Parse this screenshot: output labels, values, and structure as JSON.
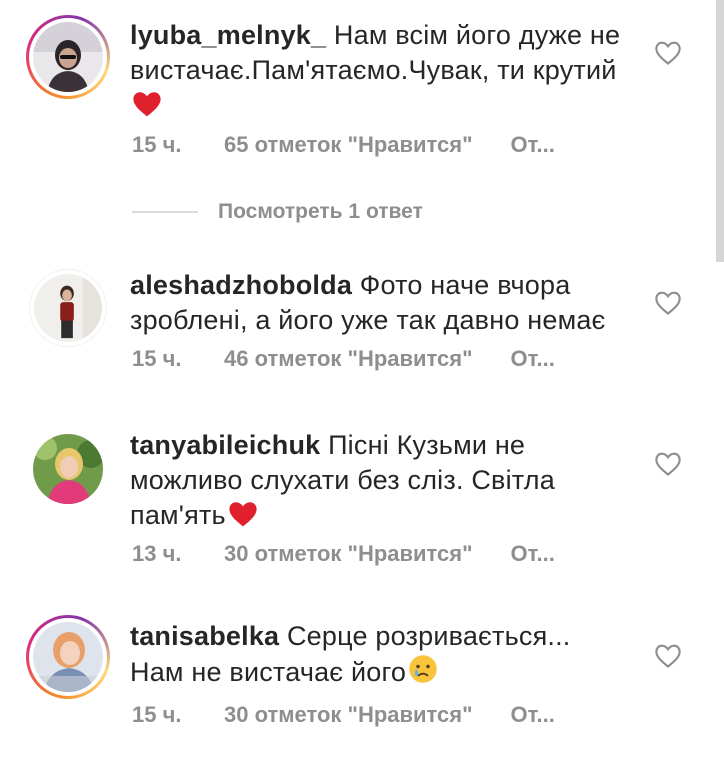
{
  "comments": [
    {
      "username": "lyuba_melnyk_",
      "text": "Нам всім його дуже не вистачає.Пам'ятаємо.Чувак, ти крутий",
      "emoji": "red-heart",
      "time": "15 ч.",
      "likes": "65 отметок \"Нравится\"",
      "reply": "От...",
      "avatar_ring": true
    },
    {
      "username": "aleshadzhobolda",
      "text": "Фото наче вчора зроблені, а його уже так давно немає",
      "emoji": "",
      "time": "15 ч.",
      "likes": "46 отметок \"Нравится\"",
      "reply": "От...",
      "avatar_ring": false
    },
    {
      "username": "tanyabileichuk",
      "text": "Пісні Кузьми не можливо слухати без сліз. Світла пам'ять",
      "emoji": "red-heart",
      "time": "13 ч.",
      "likes": "30 отметок \"Нравится\"",
      "reply": "От...",
      "avatar_ring": false
    },
    {
      "username": "tanisabelka",
      "text": "Серце розривається... Нам не вистачає його",
      "emoji": "crying-face",
      "time": "15 ч.",
      "likes": "30 отметок \"Нравится\"",
      "reply": "От...",
      "avatar_ring": true
    }
  ],
  "view_replies": {
    "label": "Посмотреть 1 ответ"
  },
  "icons": {
    "like": "heart-outline-icon"
  },
  "colors": {
    "text": "#262626",
    "meta": "#8e8e8e",
    "heart": "#e0202d"
  }
}
